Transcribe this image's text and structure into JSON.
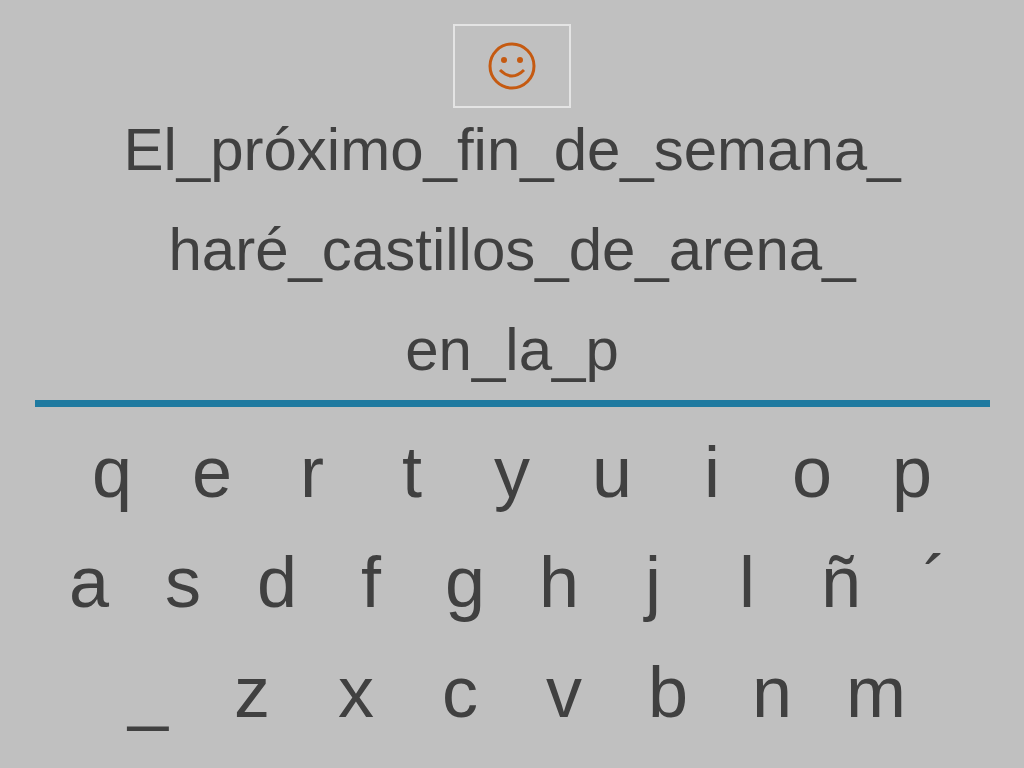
{
  "sentence_lines": [
    "El_próximo_fin_de_semana_",
    "haré_castillos_de_arena_",
    "en_la_p"
  ],
  "keyboard_rows": [
    [
      "q",
      "e",
      "r",
      "t",
      "y",
      "u",
      "i",
      "o",
      "p"
    ],
    [
      "a",
      "s",
      "d",
      "f",
      "g",
      "h",
      "j",
      "l",
      "ñ",
      "´"
    ],
    [
      "_",
      "z",
      "x",
      "c",
      "v",
      "b",
      "n",
      "m"
    ]
  ]
}
